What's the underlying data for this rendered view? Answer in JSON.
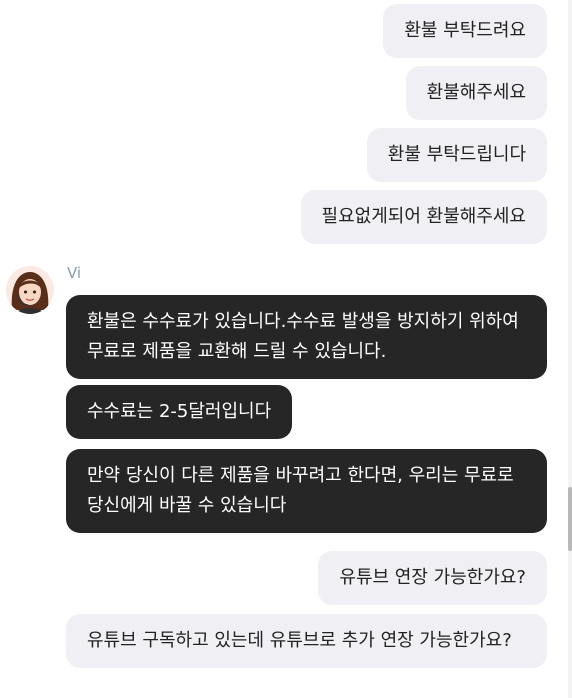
{
  "agent": {
    "name": "Vi"
  },
  "messages": [
    {
      "from": "user",
      "text": "환불 부탁드려요"
    },
    {
      "from": "user",
      "text": "환불해주세요"
    },
    {
      "from": "user",
      "text": "환불 부탁드립니다"
    },
    {
      "from": "user",
      "text": "필요없게되어 환불해주세요"
    },
    {
      "from": "agent",
      "text": "환불은 수수료가 있습니다.수수료 발생을 방지하기 위하여 무료로 제품을 교환해 드릴 수 있습니다."
    },
    {
      "from": "agent",
      "text": "수수료는 2-5달러입니다"
    },
    {
      "from": "agent",
      "text": "만약 당신이 다른 제품을 바꾸려고 한다면, 우리는 무료로 당신에게 바꿀 수 있습니다"
    },
    {
      "from": "user",
      "text": "유튜브 연장 가능한가요?"
    },
    {
      "from": "user",
      "text": "유튜브 구독하고 있는데 유튜브로 추가 연장 가능한가요?"
    }
  ],
  "colors": {
    "user_bubble": "#f0f0f4",
    "agent_bubble": "#262626",
    "agent_name": "#8a9bb0"
  }
}
